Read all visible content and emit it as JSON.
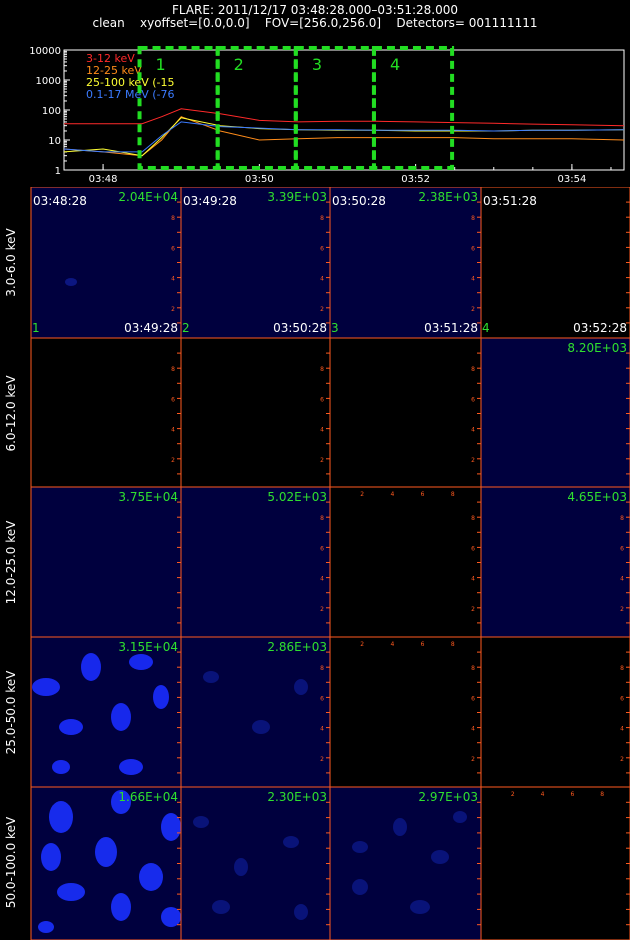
{
  "header": {
    "line1": "FLARE: 2011/12/17 03:48:28.000–03:51:28.000",
    "line2": "clean    xyoffset=[0.0,0.0]    FOV=[256.0,256.0]    Detectors= 001111111"
  },
  "lightcurve": {
    "y_ticks": [
      "10000",
      "1000",
      "100",
      "10",
      "1"
    ],
    "x_ticks": [
      "03:48",
      "03:50",
      "03:52",
      "03:54"
    ],
    "legend": [
      {
        "label": "3-12 keV",
        "color": "#ff2a2a"
      },
      {
        "label": "12-25 keV",
        "color": "#ff8c1a"
      },
      {
        "label": "25-100 keV (-15",
        "color": "#ffff33"
      },
      {
        "label": "0.1-17 MeV (-76",
        "color": "#3b7bff"
      }
    ],
    "intervals": [
      "1",
      "2",
      "3",
      "4"
    ]
  },
  "grid": {
    "row_labels": [
      "3.0-6.0 keV",
      "6.0-12.0 keV",
      "12.0-25.0 keV",
      "25.0-50.0 keV",
      "50.0-100.0 keV"
    ],
    "start_times": [
      "03:48:28",
      "03:49:28",
      "03:50:28",
      "03:51:28"
    ],
    "end_times": [
      "03:49:28",
      "03:50:28",
      "03:51:28",
      "03:52:28"
    ],
    "col_numbers": [
      "1",
      "2",
      "3",
      "4"
    ],
    "maxima": [
      [
        "2.04E+04",
        "3.39E+03",
        "2.38E+03",
        ""
      ],
      [
        "",
        "",
        "",
        "8.20E+03"
      ],
      [
        "3.75E+04",
        "5.02E+03",
        "",
        "4.65E+03"
      ],
      [
        "3.15E+04",
        "2.86E+03",
        "",
        ""
      ],
      [
        "1.66E+04",
        "2.30E+03",
        "2.97E+03",
        ""
      ]
    ],
    "axis_tick_labels": [
      "2",
      "4",
      "6",
      "8"
    ]
  },
  "chart_data": {
    "type": "line",
    "title": "FLARE: 2011/12/17 03:48:28.000–03:51:28.000",
    "xlabel": "",
    "ylabel": "",
    "y_scale": "log",
    "ylim": [
      1,
      10000
    ],
    "xlim": [
      "03:47:30",
      "03:54:40"
    ],
    "grid": false,
    "legend_position": "top-left",
    "x": [
      "03:47:30",
      "03:48:00",
      "03:48:30",
      "03:48:45",
      "03:49:00",
      "03:49:30",
      "03:50:00",
      "03:50:30",
      "03:51:00",
      "03:51:30",
      "03:52:00",
      "03:52:30",
      "03:53:00",
      "03:53:30",
      "03:54:00",
      "03:54:40"
    ],
    "series": [
      {
        "name": "3-12 keV",
        "color": "#ff2a2a",
        "values": [
          35,
          35,
          35,
          60,
          110,
          75,
          45,
          40,
          42,
          42,
          40,
          38,
          36,
          34,
          32,
          30
        ]
      },
      {
        "name": "12-25 keV",
        "color": "#ff8c1a",
        "values": [
          5,
          4,
          3,
          10,
          60,
          20,
          10,
          11,
          12,
          12,
          12,
          12,
          11,
          11,
          11,
          10
        ]
      },
      {
        "name": "25-100 keV (-15",
        "color": "#ffff33",
        "values": [
          4,
          5,
          3,
          12,
          55,
          30,
          24,
          22,
          21,
          21,
          20,
          20,
          20,
          21,
          21,
          22
        ]
      },
      {
        "name": "0.1-17 MeV (-76",
        "color": "#3b7bff",
        "values": [
          5,
          4,
          4,
          14,
          40,
          28,
          25,
          22,
          22,
          21,
          21,
          21,
          20,
          21,
          21,
          22
        ]
      }
    ]
  }
}
